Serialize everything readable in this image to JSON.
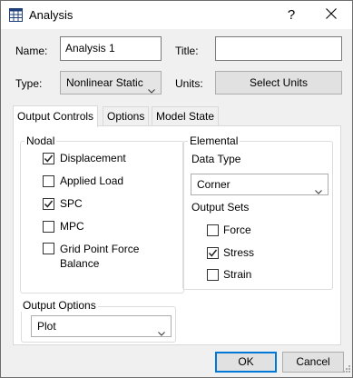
{
  "window": {
    "title": "Analysis",
    "help_glyph": "?"
  },
  "form": {
    "name_label": "Name:",
    "name_value": "Analysis 1",
    "title_label": "Title:",
    "title_value": "",
    "type_label": "Type:",
    "type_value": "Nonlinear Static",
    "units_label": "Units:",
    "select_units_label": "Select Units"
  },
  "tabs": [
    {
      "label": "Output Controls",
      "active": true
    },
    {
      "label": "Options",
      "active": false
    },
    {
      "label": "Model State",
      "active": false
    }
  ],
  "nodal": {
    "title": "Nodal",
    "items": [
      {
        "label": "Displacement",
        "checked": true
      },
      {
        "label": "Applied Load",
        "checked": false
      },
      {
        "label": "SPC",
        "checked": true
      },
      {
        "label": "MPC",
        "checked": false
      },
      {
        "label_line1": "Grid Point Force",
        "label_line2": "Balance",
        "checked": false
      }
    ]
  },
  "elemental": {
    "title": "Elemental",
    "data_type_label": "Data Type",
    "data_type_value": "Corner",
    "output_sets_label": "Output Sets",
    "items": [
      {
        "label": "Force",
        "checked": false
      },
      {
        "label": "Stress",
        "checked": true
      },
      {
        "label": "Strain",
        "checked": false
      }
    ]
  },
  "output_options": {
    "title": "Output Options",
    "value": "Plot"
  },
  "footer": {
    "ok_label": "OK",
    "cancel_label": "Cancel"
  }
}
